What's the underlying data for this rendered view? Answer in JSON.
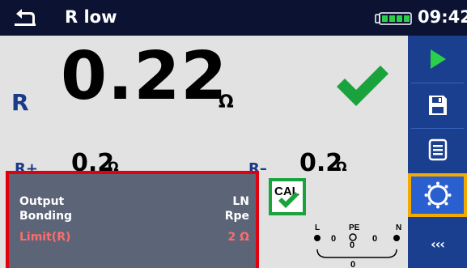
{
  "header": {
    "title": "R low",
    "time": "09:42"
  },
  "result": {
    "label": "R",
    "value": "0.22",
    "unit": "Ω"
  },
  "sub_results": {
    "r_plus": {
      "label": "R+",
      "value": "0.2",
      "unit": "Ω"
    },
    "r_minus": {
      "label": "R–",
      "value": "0.2",
      "unit": "Ω"
    }
  },
  "parameters": [
    {
      "name": "Output",
      "value": "LN"
    },
    {
      "name": "Bonding",
      "value": "Rpe"
    },
    {
      "name": "Limit(R)",
      "value": "2 Ω"
    }
  ],
  "cal": {
    "label": "CAL"
  },
  "terminals": {
    "labels": [
      "L",
      "PE",
      "N"
    ],
    "values": [
      "0",
      "0",
      "0",
      "0"
    ]
  },
  "side_buttons": [
    {
      "name": "start-button",
      "icon": "play-icon"
    },
    {
      "name": "save-button",
      "icon": "floppy-icon"
    },
    {
      "name": "memory-button",
      "icon": "list-icon"
    },
    {
      "name": "calibration-button",
      "icon": "circle-dots-icon"
    },
    {
      "name": "back-arrows-button",
      "icon": "triple-chevron-icon",
      "label": "‹‹‹"
    }
  ],
  "colors": {
    "header_bg": "#0c1232",
    "sidebar_bg": "#1a3f8f",
    "pass_green": "#1aa23d",
    "limit_red": "#ff6b6b",
    "selected_border": "#f2a900"
  }
}
